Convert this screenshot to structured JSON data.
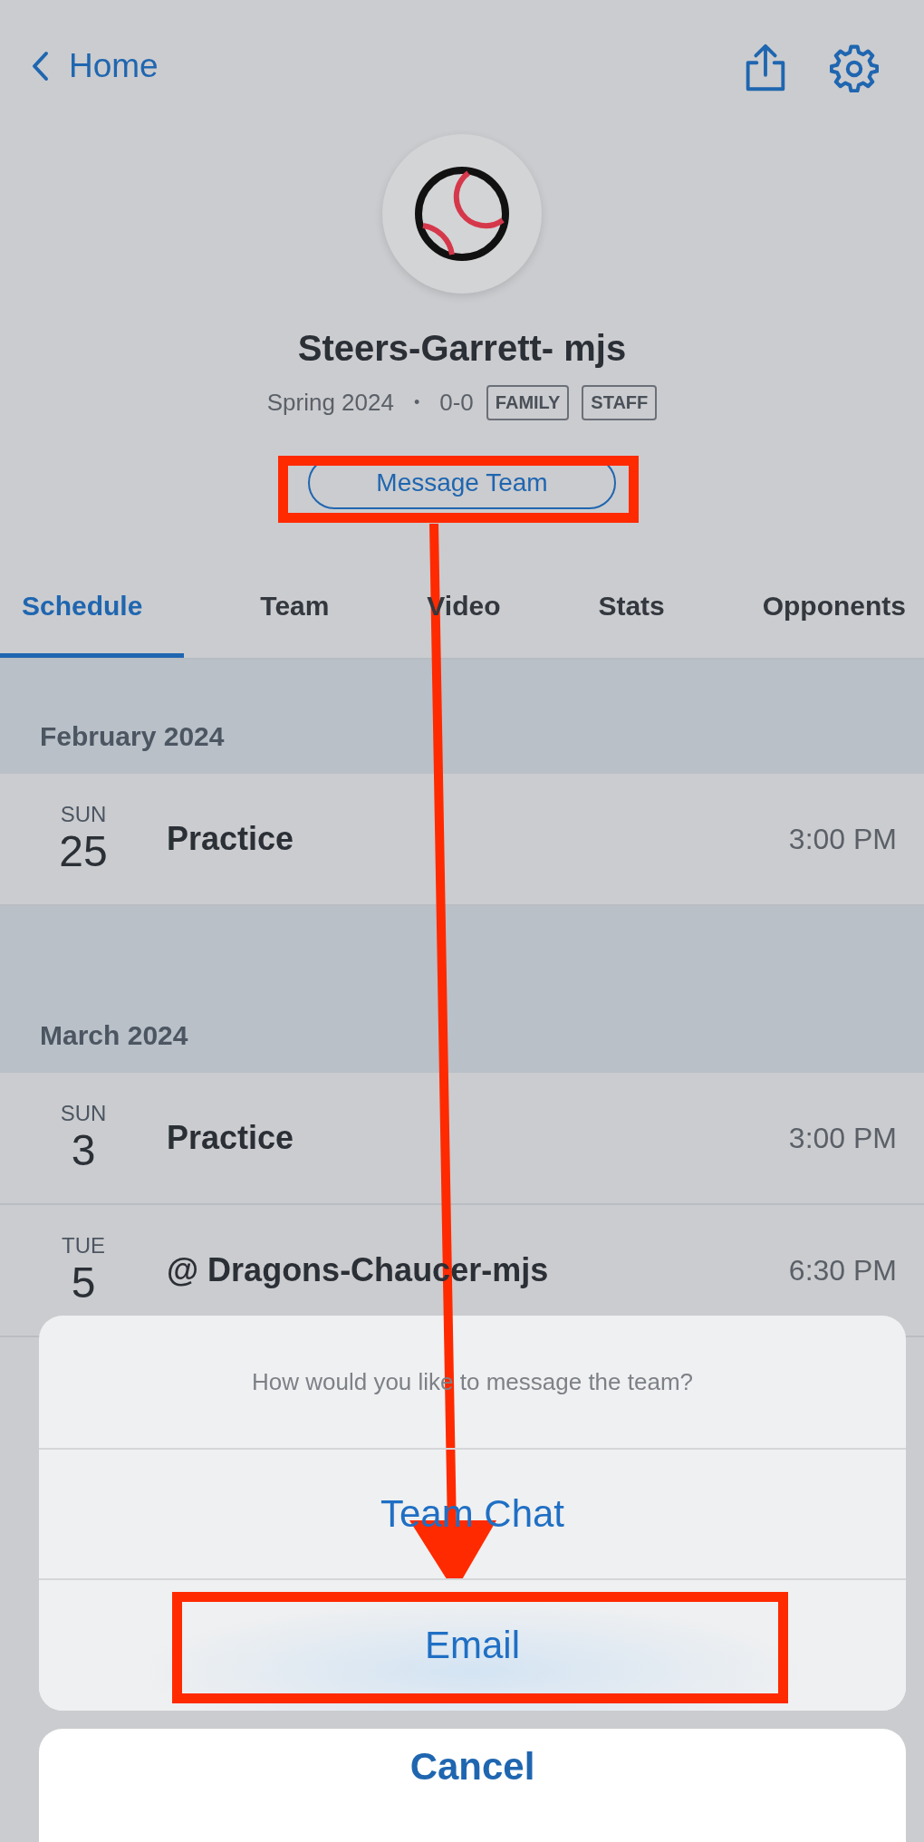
{
  "nav": {
    "back_label": "Home"
  },
  "team": {
    "name": "Steers-Garrett- mjs",
    "season": "Spring 2024",
    "separator": "•",
    "record": "0-0",
    "badges": [
      "FAMILY",
      "STAFF"
    ],
    "message_button": "Message Team"
  },
  "tabs": [
    {
      "label": "Schedule",
      "selected": true
    },
    {
      "label": "Team",
      "selected": false
    },
    {
      "label": "Video",
      "selected": false
    },
    {
      "label": "Stats",
      "selected": false
    },
    {
      "label": "Opponents",
      "selected": false
    }
  ],
  "schedule": [
    {
      "month": "February 2024",
      "events": [
        {
          "weekday": "SUN",
          "day": "25",
          "title": "Practice",
          "time": "3:00 PM"
        }
      ]
    },
    {
      "month": "March 2024",
      "events": [
        {
          "weekday": "SUN",
          "day": "3",
          "title": "Practice",
          "time": "3:00 PM"
        },
        {
          "weekday": "TUE",
          "day": "5",
          "title": "@ Dragons-Chaucer-mjs",
          "time": "6:30 PM"
        }
      ]
    }
  ],
  "action_sheet": {
    "title": "How would you like to message the team?",
    "options": [
      {
        "label": "Team Chat",
        "pressed": false
      },
      {
        "label": "Email",
        "pressed": true
      }
    ],
    "cancel": "Cancel"
  }
}
